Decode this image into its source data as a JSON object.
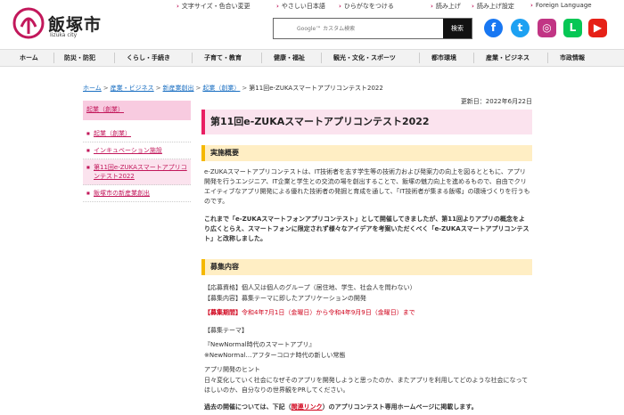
{
  "logo": {
    "name": "飯塚市",
    "sub": "Iizuka city"
  },
  "utility": [
    "文字サイズ・色合い変更",
    "やさしい日本語",
    "ひらがなをつける",
    "読み上げ",
    "読み上げ設定",
    "Foreign Language"
  ],
  "search": {
    "placeholder": "Google™ カスタム検索",
    "button": "検索"
  },
  "sns": [
    {
      "name": "facebook-icon",
      "glyph": "f",
      "color": "#1877f2"
    },
    {
      "name": "twitter-icon",
      "glyph": "t",
      "color": "#1da1f2"
    },
    {
      "name": "instagram-icon",
      "glyph": "◎",
      "color": "#c13584"
    },
    {
      "name": "line-icon",
      "glyph": "L",
      "color": "#06c755"
    },
    {
      "name": "youtube-icon",
      "glyph": "▶",
      "color": "#e62117"
    }
  ],
  "gnav": [
    "ホーム",
    "防災・防犯",
    "くらし・手続き",
    "子育て・教育",
    "健康・福祉",
    "観光・文化・スポーツ",
    "都市環境",
    "産業・ビジネス",
    "市政情報"
  ],
  "breadcrumb": [
    "ホーム",
    "産業・ビジネス",
    "新産業創出",
    "起業（創業）",
    "第11回e-ZUKAスマートアプリコンテスト2022"
  ],
  "sidebar": {
    "head": "起業（創業）",
    "items": [
      "起業（創業）",
      "インキュベーション施設",
      "第11回e-ZUKAスマートアプリコンテスト2022",
      "飯塚市の新産業創出"
    ]
  },
  "main": {
    "updated": "更新日：2022年6月22日",
    "title": "第11回e-ZUKAスマートアプリコンテスト2022",
    "section1": {
      "heading": "実施概要",
      "p1": "e-ZUKAスマートアプリコンテストは、IT技術者を志す学生等の技術力および発案力の向上を図るとともに、アプリ開発を行うエンジニア、IT企業と学生との交流の場を創出することで、飯塚の魅力向上を進めるもので、自由でクリエイティブなアプリ開発による優れた技術者の発掘と育成を通して、「IT技術者が集まる飯塚」の環境づくりを行うものです。",
      "p2": "これまで「e-ZUKAスマートフォンアプリコンテスト」として開催してきましたが、第11回よりアプリの概念をより広くとらえ、スマートフォンに限定されず様々なアイデアを考案いただくべく「e-ZUKAスマートアプリコンテスト」と改称しました。"
    },
    "section2": {
      "heading": "募集内容",
      "l1": "【応募資格】個人又は個人のグループ（居住地、学生、社会人を問わない）",
      "l2": "【募集内容】募集テーマに即したアプリケーションの開発",
      "l3_label": "【募集期間】",
      "l3_value": "令和4年7月1日（金曜日）から令和4年9月9日（金曜日）まで",
      "l4": "【募集テーマ】",
      "l5": "『NewNormal時代のスマートアプリ』",
      "l6": "※NewNormal…アフターコロナ時代の新しい常態",
      "l7": "アプリ開発のヒント",
      "l8": "日々変化していく社会になぜそのアプリを開発しようと思ったのか、またアプリを利用してどのような社会になってほしいのか、自分なりの世界観をPRしてください。",
      "l9_pre": "過去の開催については、下記（",
      "l9_link": "関連リンク",
      "l9_post": "）のアプリコンテスト専用ホームページに掲載します。"
    }
  }
}
